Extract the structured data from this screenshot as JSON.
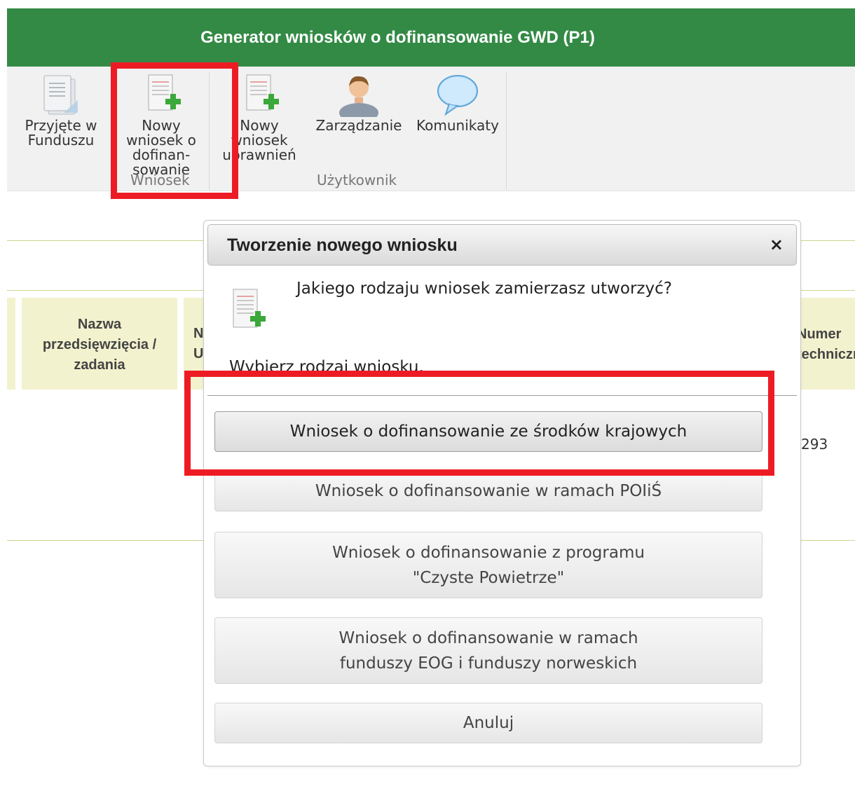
{
  "app": {
    "title": "Generator wniosków o dofinansowanie GWD (P1)"
  },
  "ribbon": {
    "buttons": {
      "received": "Przyjęte w\nFunduszu",
      "new_application": "Nowy\nwniosek o\ndofinan-\nsowanie",
      "new_authorization": "Nowy\nwniosek\nuprawnień",
      "management": "Zarządzanie",
      "messages": "Komunikaty"
    },
    "groups": {
      "application": "Wniosek",
      "user": "Użytkownik"
    }
  },
  "table": {
    "headers": {
      "project_name": "Nazwa\nprzedsięwzięcia /\nzadania",
      "left_fragment": "N\nU",
      "tech_number": "Numer\ntechniczny"
    },
    "cells": {
      "tech_number_value": "293"
    }
  },
  "dialog": {
    "title": "Tworzenie nowego wniosku",
    "close": "×",
    "question": "Jakiego rodzaju wniosek zamierzasz utworzyć?",
    "subtitle": "Wybierz rodzaj wniosku.",
    "options": [
      "Wniosek o dofinansowanie ze środków krajowych",
      "Wniosek o dofinansowanie w ramach POIiŚ",
      "Wniosek o dofinansowanie z programu\n\"Czyste Powietrze\"",
      "Wniosek o dofinansowanie w ramach\nfunduszy EOG i funduszy norweskich",
      "Anuluj"
    ]
  },
  "colors": {
    "title_bar": "#338a45",
    "highlight": "#ed1c24",
    "table_header": "#f3f2ce"
  },
  "icons": {
    "received": "document-stack-icon",
    "new_application": "document-add-icon",
    "new_authorization": "document-add-icon",
    "management": "user-icon",
    "messages": "speech-bubble-icon"
  }
}
